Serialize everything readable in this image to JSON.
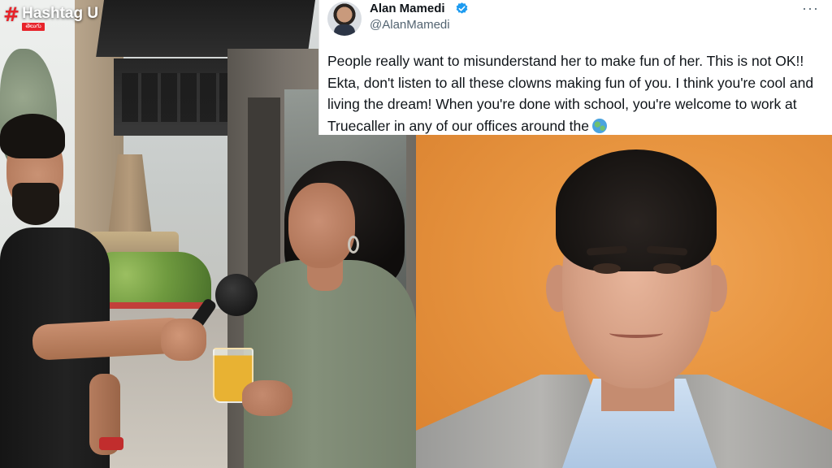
{
  "watermark": {
    "hash_symbol": "#",
    "brand_name": "Hashtag U",
    "language_tag": "తెలుగు",
    "brand_color": "#e8232a"
  },
  "tweet": {
    "author_name": "Alan Mamedi",
    "author_handle": "@AlanMamedi",
    "verified_icon": "verified-badge-icon",
    "more_icon": "more-options-icon",
    "more_glyph": "···",
    "body": "People really want to misunderstand her to make fun of her. This is not OK!! Ekta, don't listen to all these clowns making fun of you. I think you're cool and living the dream! When you're done with school, you're welcome to work at Truecaller in any of our offices around the",
    "emoji_icon": "globe-earth-icon",
    "verified_color": "#1d9bf0"
  },
  "photos": {
    "left_scene": "street-interview-photo",
    "right_scene": "portrait-photo",
    "portrait_background_color": "#e7943f"
  }
}
